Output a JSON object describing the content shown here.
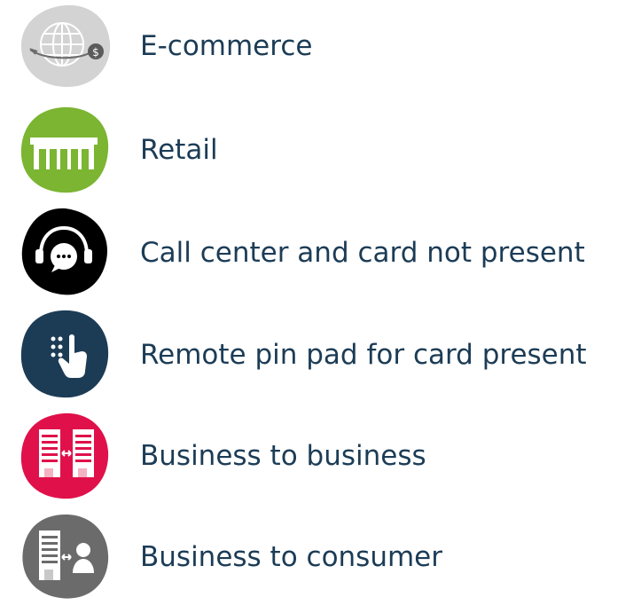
{
  "items": [
    {
      "label": "E-commerce",
      "icon": "globe-dollar-icon",
      "color": "#d3d3d3"
    },
    {
      "label": "Retail",
      "icon": "storefront-icon",
      "color": "#7bb531"
    },
    {
      "label": "Call center and card not present",
      "icon": "headset-chat-icon",
      "color": "#000000"
    },
    {
      "label": "Remote pin pad for card present",
      "icon": "keypad-hand-icon",
      "color": "#1c3c56"
    },
    {
      "label": "Business to business",
      "icon": "buildings-exchange-icon",
      "color": "#e0114a"
    },
    {
      "label": "Business to consumer",
      "icon": "building-person-exchange-icon",
      "color": "#6b6b6b"
    }
  ],
  "text_color": "#1c3c56"
}
